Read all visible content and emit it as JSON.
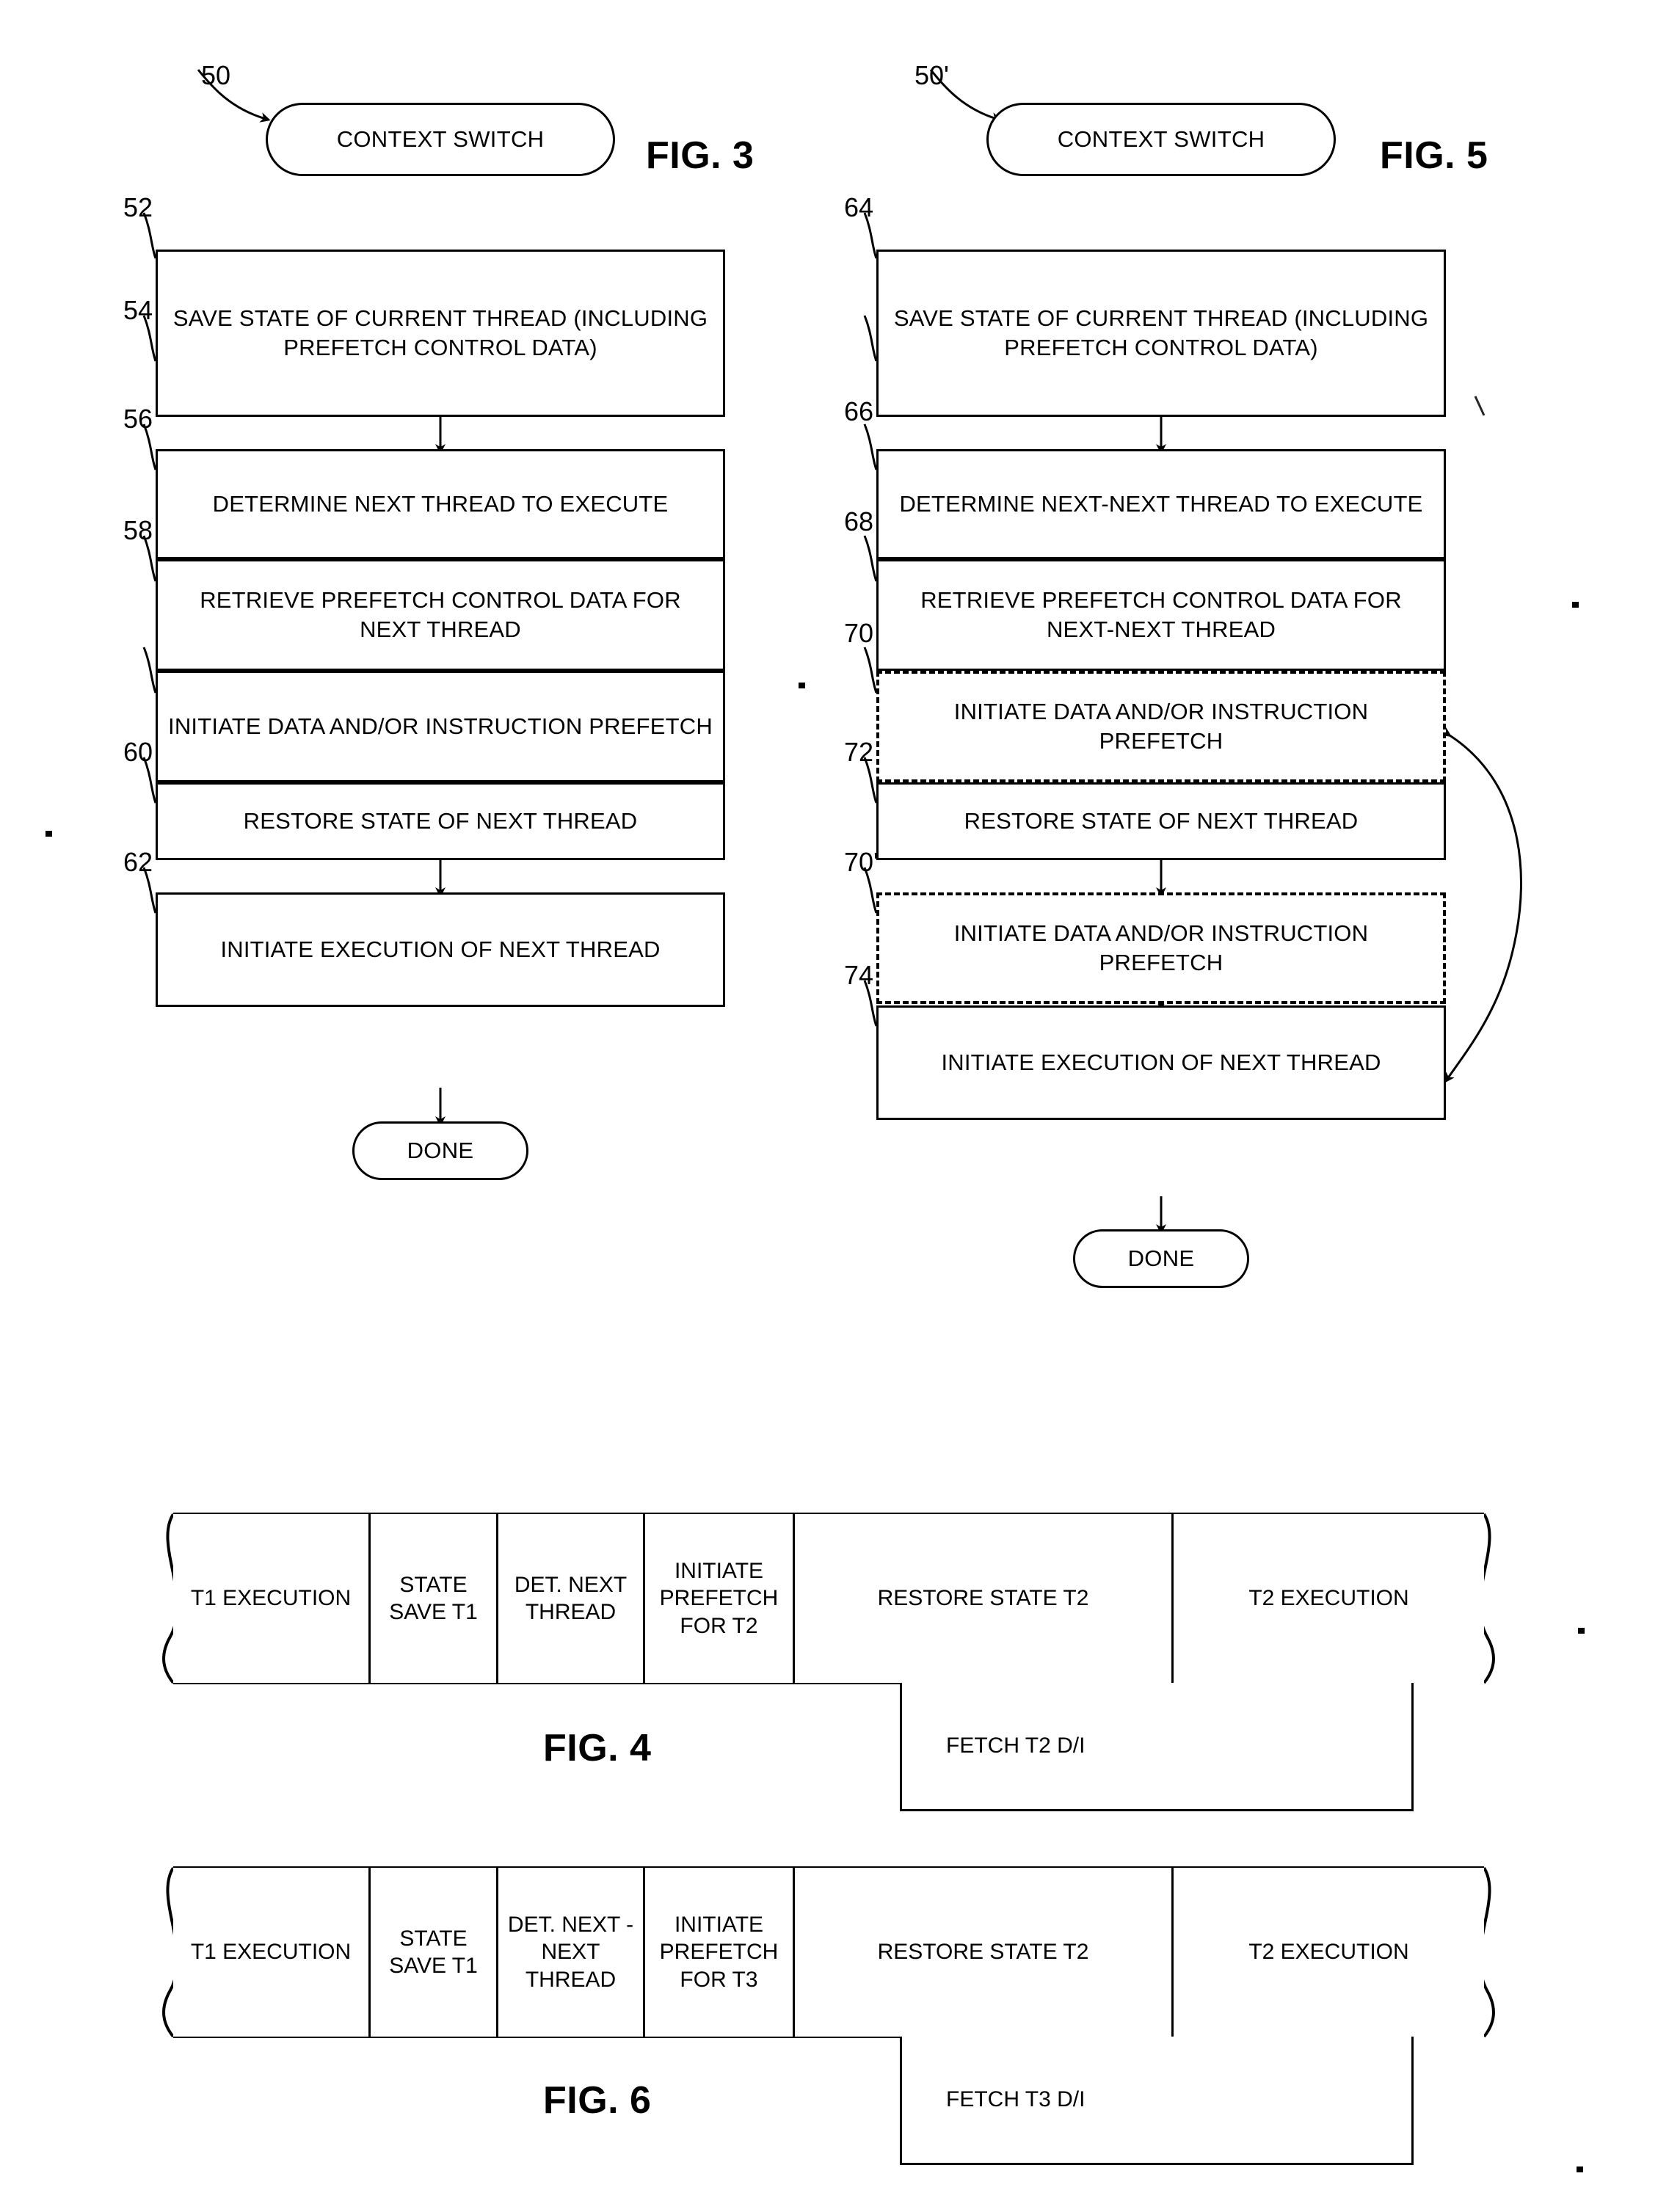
{
  "figures": {
    "fig3": {
      "caption": "FIG. 3",
      "start_ref": "50",
      "terminal_start": "CONTEXT SWITCH",
      "terminal_end": "DONE",
      "steps": [
        {
          "ref": "52",
          "text": "SAVE STATE OF CURRENT THREAD (INCLUDING PREFETCH CONTROL DATA)",
          "style": "solid"
        },
        {
          "ref": "54",
          "text": "DETERMINE NEXT THREAD TO EXECUTE",
          "style": "solid"
        },
        {
          "ref": "56",
          "text": "RETRIEVE PREFETCH CONTROL DATA FOR NEXT THREAD",
          "style": "solid"
        },
        {
          "ref": "58",
          "text": "INITIATE DATA AND/OR INSTRUCTION PREFETCH",
          "style": "solid"
        },
        {
          "ref": "60",
          "text": "RESTORE STATE OF NEXT THREAD",
          "style": "solid"
        },
        {
          "ref": "62",
          "text": "INITIATE EXECUTION OF NEXT THREAD",
          "style": "solid"
        }
      ]
    },
    "fig5": {
      "caption": "FIG. 5",
      "start_ref": "50'",
      "terminal_start": "CONTEXT SWITCH",
      "terminal_end": "DONE",
      "steps": [
        {
          "ref": "64",
          "text": "SAVE STATE OF CURRENT THREAD (INCLUDING PREFETCH CONTROL DATA)",
          "style": "solid"
        },
        {
          "ref": "66",
          "text": "DETERMINE NEXT-NEXT THREAD TO EXECUTE",
          "style": "solid"
        },
        {
          "ref": "68",
          "text": "RETRIEVE PREFETCH CONTROL DATA FOR NEXT-NEXT THREAD",
          "style": "solid"
        },
        {
          "ref": "70",
          "text": "INITIATE DATA AND/OR INSTRUCTION PREFETCH",
          "style": "dashed"
        },
        {
          "ref": "72",
          "text": "RESTORE STATE OF NEXT THREAD",
          "style": "solid"
        },
        {
          "ref": "70'",
          "text": "INITIATE DATA AND/OR INSTRUCTION PREFETCH",
          "style": "dashed"
        },
        {
          "ref": "74",
          "text": "INITIATE EXECUTION OF NEXT THREAD",
          "style": "solid"
        }
      ]
    },
    "fig4": {
      "caption": "FIG. 4",
      "cells": [
        "T1 EXECUTION",
        "STATE SAVE T1",
        "DET. NEXT THREAD",
        "INITIATE PREFETCH FOR T2",
        "RESTORE STATE T2",
        "T2 EXECUTION"
      ],
      "fetch_label": "FETCH T2 D/I"
    },
    "fig6": {
      "caption": "FIG. 6",
      "cells": [
        "T1 EXECUTION",
        "STATE SAVE T1",
        "DET. NEXT -NEXT THREAD",
        "INITIATE PREFETCH FOR T3",
        "RESTORE STATE T2",
        "T2 EXECUTION"
      ],
      "fetch_label": "FETCH T3 D/I"
    }
  },
  "colors": {
    "ink": "#000000",
    "paper": "#ffffff"
  }
}
